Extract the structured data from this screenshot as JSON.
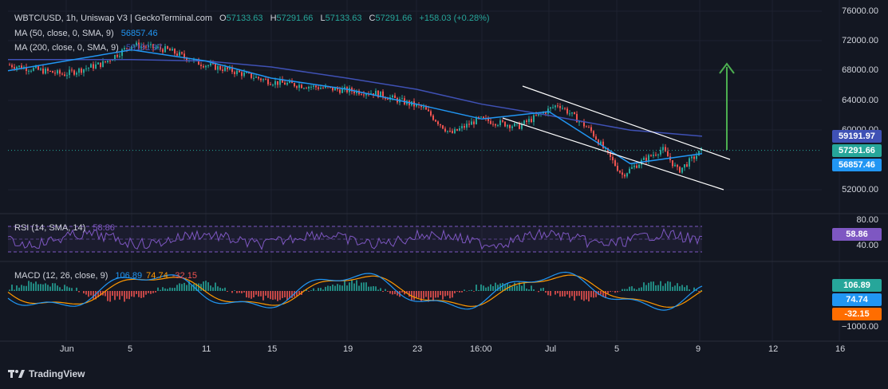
{
  "colors": {
    "background": "#131722",
    "grid": "#1e2230",
    "up": "#26a69a",
    "down": "#ef5350",
    "ma50": "#2196f3",
    "ma200": "#3f51b5",
    "rsi": "#7e57c2",
    "macd": "#2196f3",
    "signal": "#ff9800",
    "arrow": "#4caf50",
    "channel": "#ffffff"
  },
  "header": {
    "symbol": "WBTC/USD, 1h, Uniswap V3 | GeckoTerminal.com",
    "open_label": "O",
    "open": "57133.63",
    "high_label": "H",
    "high": "57291.66",
    "low_label": "L",
    "low": "57133.63",
    "close_label": "C",
    "close": "57291.66",
    "change": "+158.03 (+0.28%)"
  },
  "ma50": {
    "label": "MA (50, close, 0, SMA, 9)",
    "value": "56857.46"
  },
  "ma200": {
    "label": "MA (200, close, 0, SMA, 9)",
    "value": "59191.97"
  },
  "rsi": {
    "label": "RSI (14, SMA, 14)",
    "value": "58.86",
    "axis": [
      "80.00",
      "40.00"
    ]
  },
  "macd": {
    "label": "MACD (12, 26, close, 9)",
    "macd": "106.89",
    "signal": "74.74",
    "hist": "-32.15",
    "axis_low": "−1000.00"
  },
  "price_axis": [
    "76000.00",
    "72000.00",
    "68000.00",
    "64000.00",
    "60000.00",
    "52000.00"
  ],
  "price_tags": {
    "ma200": "59191.97",
    "last": "57291.66",
    "ma50": "56857.46"
  },
  "time_axis": [
    "Jun",
    "5",
    "11",
    "15",
    "19",
    "23",
    "16:00",
    "Jul",
    "5",
    "9",
    "12",
    "16"
  ],
  "brand": "TradingView",
  "chart_data": {
    "type": "line",
    "title": "WBTC/USD, 1h, Uniswap V3",
    "x": [
      "Jun",
      "5",
      "11",
      "15",
      "19",
      "23",
      "16:00",
      "Jul",
      "5",
      "9"
    ],
    "series": [
      {
        "name": "WBTC/USD close",
        "values": [
          68500,
          71000,
          69000,
          66500,
          65000,
          63000,
          61500,
          62500,
          54500,
          57291.66
        ]
      },
      {
        "name": "MA (50, close, 0, SMA, 9)",
        "values": [
          68000,
          70500,
          69500,
          67000,
          65500,
          63500,
          61500,
          62000,
          56000,
          56857.46
        ]
      },
      {
        "name": "MA (200, close, 0, SMA, 9)",
        "values": [
          69500,
          69500,
          69500,
          68500,
          67000,
          65500,
          63500,
          62000,
          60000,
          59191.97
        ]
      }
    ],
    "ylim": [
      50000,
      76000
    ],
    "rsi_last": 58.86,
    "macd_last": {
      "macd": 106.89,
      "signal": 74.74,
      "histogram": -32.15
    }
  }
}
